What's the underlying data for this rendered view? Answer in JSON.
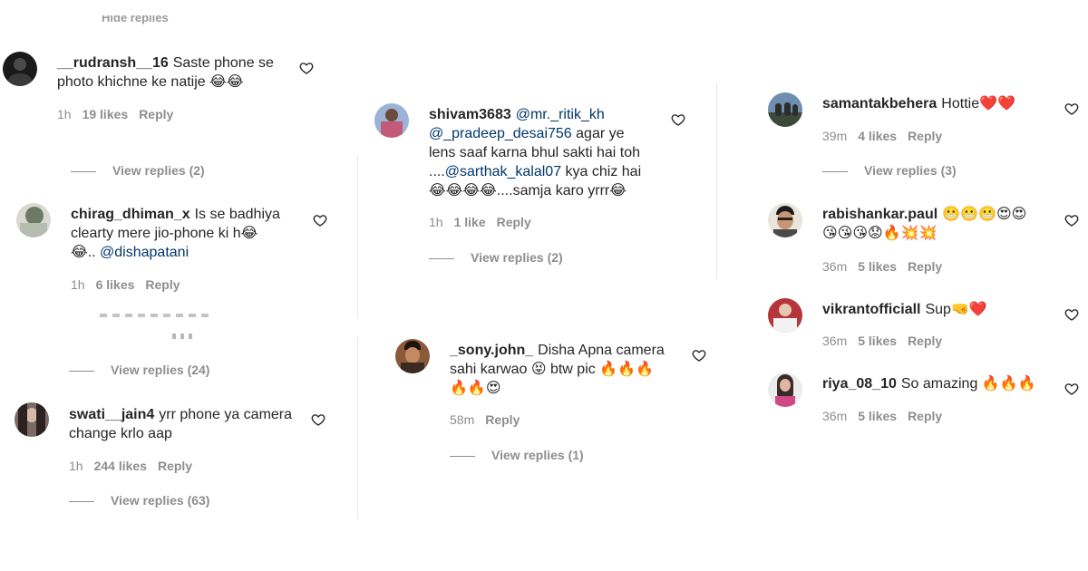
{
  "top_faded_text": "Hide replies",
  "col1": {
    "c1": {
      "username": "__rudransh__16",
      "line1": "Saste phone se",
      "line2": "photo khichne ke natije 😂😂",
      "time": "1h",
      "likes": "19 likes",
      "reply": "Reply"
    },
    "c1_replies": "View replies (2)",
    "c2": {
      "username": "chirag_dhiman_x",
      "line1": "Is se badhiya",
      "line2": "clearty mere jio-phone ki h😂",
      "line3_prefix": "😂.. ",
      "mention": "@dishapatani",
      "time": "1h",
      "likes": "6 likes",
      "reply": "Reply"
    },
    "c3_replies": "View replies (24)",
    "c4": {
      "username": "swati__jain4",
      "line1": "yrr phone ya camera",
      "line2": "change krlo aap",
      "time": "1h",
      "likes": "244 likes",
      "reply": "Reply"
    },
    "c4_replies": "View replies (63)"
  },
  "col2": {
    "c1": {
      "username": "shivam3683",
      "mention1": "@mr._ritik_kh",
      "mention2": "@_pradeep_desai756",
      "after_mention2": " agar ye",
      "line3": "lens saaf karna bhul sakti hai toh",
      "line4_prefix": "....",
      "mention3": "@sarthak_kalal07",
      "line4_suffix": " kya chiz hai",
      "line5": "😂😂😂😂....samja karo yrrr😂",
      "time": "1h",
      "likes": "1 like",
      "reply": "Reply"
    },
    "c1_replies": "View replies (2)",
    "c2": {
      "username": "_sony.john_",
      "line1": "Disha Apna camera",
      "line2": "sahi karwao 😝 btw pic 🔥🔥🔥",
      "line3": "🔥🔥😍",
      "time": "58m",
      "reply": "Reply"
    },
    "c2_replies": "View replies (1)"
  },
  "col3": {
    "c1": {
      "username": "samantakbehera",
      "text": "Hottie❤️❤️",
      "time": "39m",
      "likes": "4 likes",
      "reply": "Reply"
    },
    "c1_replies": "View replies (3)",
    "c2": {
      "username": "rabishankar.paul",
      "line1": "😬😬😬😍😍",
      "line2": "😘😘😘😟🔥💥💥",
      "time": "36m",
      "likes": "5 likes",
      "reply": "Reply"
    },
    "c3": {
      "username": "vikrantofficiall",
      "text": "Sup🤜❤️",
      "time": "36m",
      "likes": "5 likes",
      "reply": "Reply"
    },
    "c4": {
      "username": "riya_08_10",
      "text": "So amazing 🔥🔥🔥",
      "time": "36m",
      "likes": "5 likes",
      "reply": "Reply"
    }
  },
  "colors": {
    "text": "#262626",
    "meta": "#8e8e8e",
    "mention": "#00376b",
    "divider": "#e6e6e6"
  },
  "icons": {
    "like": "heart-outline-icon"
  }
}
